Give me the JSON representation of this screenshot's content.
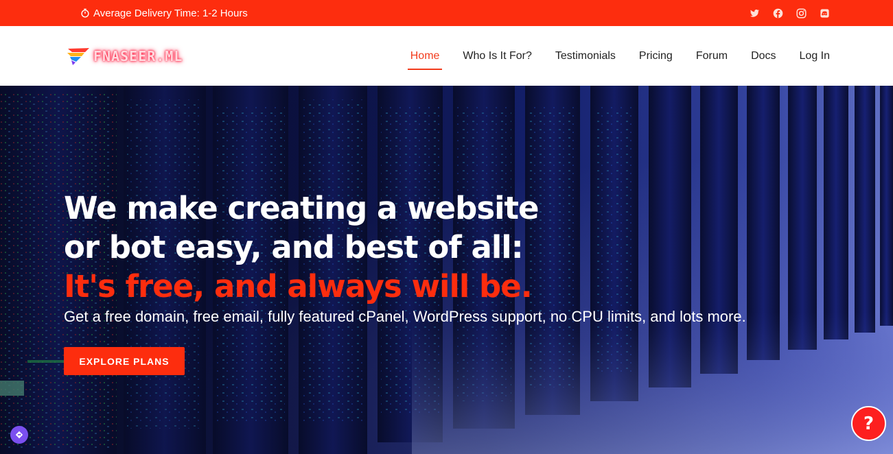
{
  "topbar": {
    "delivery_text": "Average Delivery Time: 1-2 Hours",
    "background": "#fd2d0e",
    "social_icons": [
      "twitter-icon",
      "facebook-icon",
      "instagram-icon",
      "discord-icon"
    ]
  },
  "header": {
    "logo_text": "FNASEER.ML",
    "nav": {
      "home": "Home",
      "who": "Who Is It For?",
      "testimonials": "Testimonials",
      "pricing": "Pricing",
      "forum": "Forum",
      "docs": "Docs",
      "login": "Log In"
    },
    "active_item": "Home",
    "accent": "#f23b1c"
  },
  "hero": {
    "line1": "We make creating a website",
    "line2": "or bot easy, and best of all:",
    "line3": "It's free, and always will be.",
    "subtitle": "Get a free domain, free email, fully featured cPanel, WordPress support, no CPU limits, and lots more.",
    "cta_label": "EXPLORE PLANS"
  },
  "widgets": {
    "help_label": "?",
    "help_color": "#fd1f1f",
    "nav_widget_color": "#7b4ff0"
  }
}
